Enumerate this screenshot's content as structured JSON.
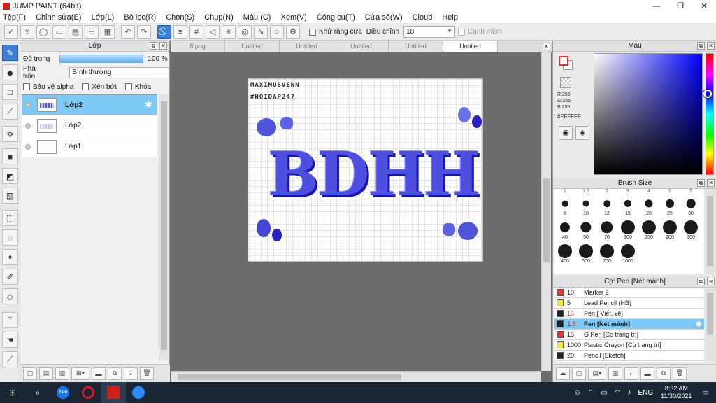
{
  "window": {
    "title": "JUMP PAINT (64bit)",
    "minimize": "—",
    "maximize": "❐",
    "close": "✕"
  },
  "menu": [
    "Tệp(F)",
    "Chỉnh sửa(E)",
    "Lớp(L)",
    "Bộ lọc(R)",
    "Chọn(S)",
    "Chụp(N)",
    "Màu (C)",
    "Xem(V)",
    "Công cụ(T)",
    "Cửa số(W)",
    "Cloud",
    "Help"
  ],
  "toolbar": {
    "antialias_label": "Khử răng cưa",
    "adjust_label": "Điều chỉnh",
    "adjust_value": "18",
    "smooth_label": "Cạnh mềm"
  },
  "layer_panel": {
    "title": "Lớp",
    "opacity_label": "Độ trong",
    "opacity_value": "100 %",
    "opacity_fraction": 1.0,
    "blend_label": "Pha trộn",
    "blend_value": "Bình thường",
    "protect_alpha": "Bảo vệ alpha",
    "clip": "Xén bớt",
    "lock": "Khóa",
    "layers": [
      {
        "name": "Lớp2",
        "selected": true
      },
      {
        "name": "Lớp2",
        "selected": false
      },
      {
        "name": "Lớp1",
        "selected": false
      }
    ]
  },
  "tabs": [
    "8.png",
    "Untitled",
    "Untitled",
    "Untitled",
    "Untitled",
    "Untitled"
  ],
  "canvas": {
    "line1": "MAXIMUSVENN",
    "line2": "#HOIDAP247",
    "art": "BDHH"
  },
  "color_panel": {
    "title": "Màu",
    "r": "R:255",
    "g": "G:255",
    "b": "B:255",
    "hex": "#FFFFFF"
  },
  "brush_size": {
    "title": "Brush Size",
    "top_row": [
      "1",
      "1.5",
      "2",
      "3",
      "4",
      "5",
      "7"
    ],
    "sizes": [
      "8",
      "10",
      "12",
      "15",
      "20",
      "25",
      "30",
      "40",
      "50",
      "70",
      "100",
      "150",
      "200",
      "300",
      "400",
      "500",
      "700",
      "1000"
    ]
  },
  "pens": {
    "title": "Cọ: Pen [Nét mảnh]",
    "items": [
      {
        "size": "10",
        "name": "Marker 2",
        "color": "#e53935",
        "red": false,
        "selected": false
      },
      {
        "size": "5",
        "name": "Lead Pencil (HB)",
        "color": "#f5e82a",
        "red": false,
        "selected": false
      },
      {
        "size": "15",
        "name": "Pen [ Viết, vẽ]",
        "color": "#222222",
        "red": true,
        "selected": false
      },
      {
        "size": "1.5",
        "name": "Pen [Nét mảnh]",
        "color": "#222222",
        "red": true,
        "selected": true
      },
      {
        "size": "15",
        "name": "G Pen [Cọ trang trí]",
        "color": "#e53935",
        "red": false,
        "selected": false
      },
      {
        "size": "1000",
        "name": "Plastic Crayon [Cọ trang trí]",
        "color": "#f5e82a",
        "red": false,
        "selected": false
      },
      {
        "size": "20",
        "name": "Pencil [Sketch]",
        "color": "#222222",
        "red": false,
        "selected": false
      }
    ]
  },
  "taskbar": {
    "zalo": "Zalo",
    "lang": "ENG",
    "time": "8:32 AM",
    "date": "11/30/2021"
  },
  "colors": {
    "accent": "#3b7fd6",
    "selection": "#7cc9f5",
    "art_blue": "#4d4fe0"
  }
}
